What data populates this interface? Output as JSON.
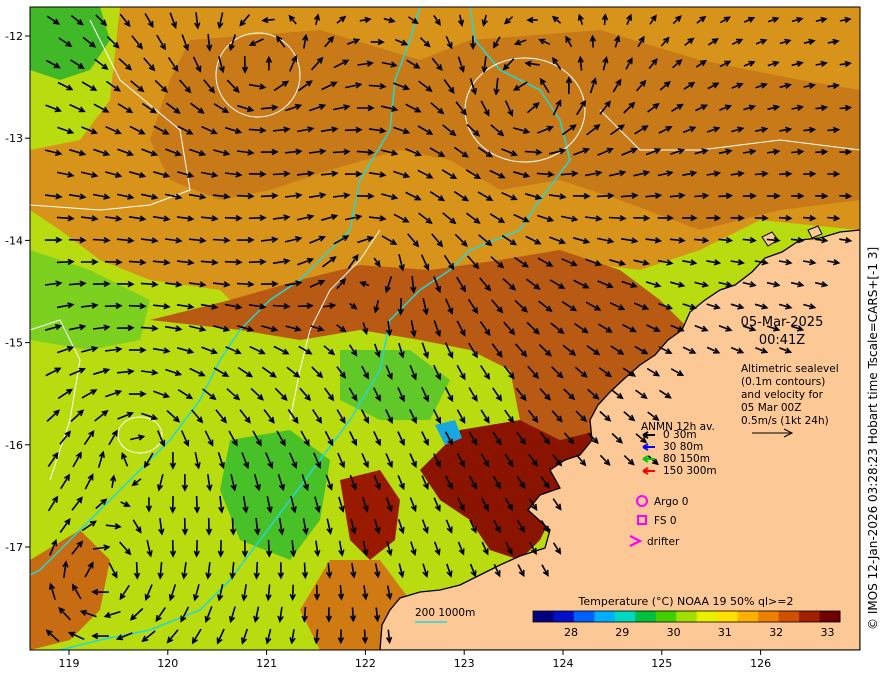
{
  "figure": {
    "date": "05-Mar-2025",
    "time": "00:41Z",
    "sealevel_note": [
      "Altimetric sealevel",
      "(0.1m contours)",
      "and velocity for",
      "05 Mar 00Z",
      "0.5m/s (1kt 24h)"
    ],
    "credit": "© IMOS 12-Jan-2026 03:28:23 Hobart time Tscale=CARS+[-1 3]",
    "isobath_label": "200  1000m"
  },
  "axes": {
    "lon_ticks": [
      "119",
      "120",
      "121",
      "122",
      "123",
      "124",
      "125",
      "126"
    ],
    "lat_ticks": [
      "-12",
      "-13",
      "-14",
      "-15",
      "-16",
      "-17"
    ]
  },
  "mooring_legend": {
    "title": "ANMN 12h av.",
    "entries": [
      {
        "label": "0 30m",
        "color": "#000000"
      },
      {
        "label": "30 80m",
        "color": "#0000ff"
      },
      {
        "label": "80 150m",
        "color": "#00cc00"
      },
      {
        "label": "150 300m",
        "color": "#ff0000"
      }
    ]
  },
  "symbol_legend": {
    "argo": "Argo 0",
    "fs": "FS 0",
    "drifter": "drifter",
    "color": "#ff00ff"
  },
  "colorbar": {
    "title": "Temperature (°C) NOAA 19 50% ql>=2",
    "ticks": [
      "28",
      "29",
      "30",
      "31",
      "32",
      "33"
    ],
    "colors": [
      "#000080",
      "#0010c8",
      "#0060ff",
      "#00b0ff",
      "#00d8c0",
      "#00c040",
      "#40d000",
      "#a0e000",
      "#e8f000",
      "#ffe000",
      "#ffb000",
      "#f08000",
      "#d05000",
      "#a02000",
      "#700000"
    ]
  },
  "colors": {
    "land": "#fcc896",
    "warm": "#d8861a",
    "hot": "#a04010",
    "veryhot": "#8a1000",
    "cool": "#c0e000",
    "cooler": "#40c020",
    "isobath": "#20d0d0",
    "contour": "#ffffff",
    "arrow": "#000000"
  }
}
